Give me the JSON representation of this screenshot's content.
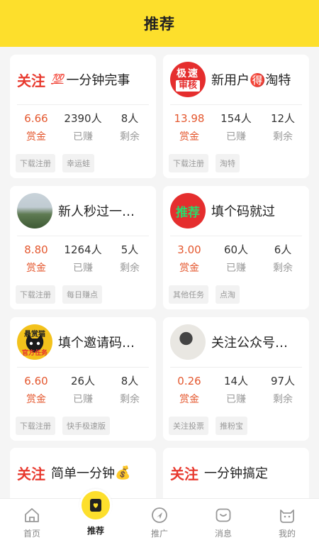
{
  "header": {
    "title": "推荐"
  },
  "cards": [
    {
      "title": "一分钟完事",
      "badge": "关注",
      "emoji": "💯",
      "avatar": null,
      "reward": "6.66",
      "earned": "2390人",
      "remaining": "8人",
      "labels": {
        "reward": "赏金",
        "earned": "已赚",
        "remaining": "剩余"
      },
      "tags": [
        "下载注册",
        "幸运蛙"
      ]
    },
    {
      "title": "新用户🉐淘特",
      "badge": null,
      "emoji": null,
      "avatar": {
        "kind": "fast",
        "line1": "极速",
        "line2": "审核"
      },
      "reward": "13.98",
      "earned": "154人",
      "remaining": "12人",
      "labels": {
        "reward": "赏金",
        "earned": "已赚",
        "remaining": "剩余"
      },
      "tags": [
        "下载注册",
        "淘特"
      ]
    },
    {
      "title": "新人秒过一…",
      "badge": null,
      "emoji": null,
      "avatar": {
        "kind": "mountain"
      },
      "reward": "8.80",
      "earned": "1264人",
      "remaining": "5人",
      "labels": {
        "reward": "赏金",
        "earned": "已赚",
        "remaining": "剩余"
      },
      "tags": [
        "下载注册",
        "每日赚点"
      ]
    },
    {
      "title": "填个码就过",
      "badge": null,
      "emoji": null,
      "avatar": {
        "kind": "recommend",
        "text": "推荐"
      },
      "reward": "3.00",
      "earned": "60人",
      "remaining": "6人",
      "labels": {
        "reward": "赏金",
        "earned": "已赚",
        "remaining": "剩余"
      },
      "tags": [
        "其他任务",
        "点淘"
      ]
    },
    {
      "title": "填个邀请码…",
      "badge": null,
      "emoji": null,
      "avatar": {
        "kind": "cat",
        "top": "悬赏猫",
        "bottom": "官方任务"
      },
      "reward": "6.60",
      "earned": "26人",
      "remaining": "8人",
      "labels": {
        "reward": "赏金",
        "earned": "已赚",
        "remaining": "剩余"
      },
      "tags": [
        "下载注册",
        "快手极速版"
      ]
    },
    {
      "title": "关注公众号…",
      "badge": null,
      "emoji": null,
      "avatar": {
        "kind": "photo"
      },
      "reward": "0.26",
      "earned": "14人",
      "remaining": "97人",
      "labels": {
        "reward": "赏金",
        "earned": "已赚",
        "remaining": "剩余"
      },
      "tags": [
        "关注投票",
        "推粉宝"
      ]
    },
    {
      "title": "简单一分钟",
      "badge": "关注",
      "emoji": "💰",
      "avatar": null
    },
    {
      "title": "一分钟搞定",
      "badge": "关注",
      "emoji": null,
      "avatar": null
    }
  ],
  "tabs": [
    {
      "label": "首页",
      "icon": "home-icon"
    },
    {
      "label": "推荐",
      "icon": "bookmark-heart-icon",
      "active": true
    },
    {
      "label": "推广",
      "icon": "send-icon"
    },
    {
      "label": "消息",
      "icon": "message-icon"
    },
    {
      "label": "我的",
      "icon": "cat-profile-icon"
    }
  ],
  "colors": {
    "brand": "#fddf2c",
    "reward": "#e4572e",
    "badge": "#e8392e"
  }
}
